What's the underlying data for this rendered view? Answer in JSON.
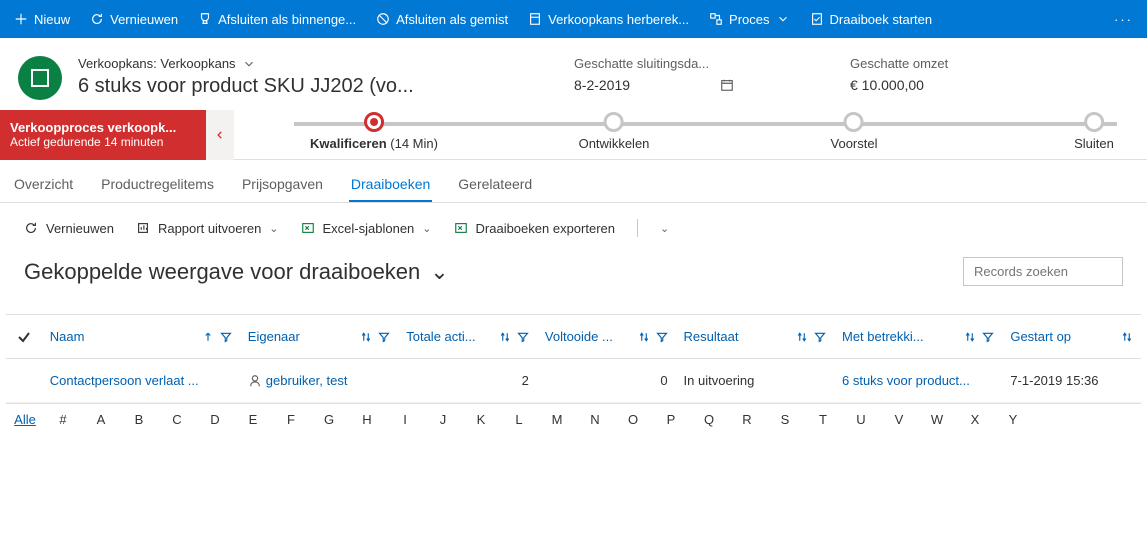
{
  "cmdbar": {
    "nieuw": "Nieuw",
    "vernieuwen": "Vernieuwen",
    "bin": "Afsluiten als binnenge...",
    "gemist": "Afsluiten als gemist",
    "herber": "Verkoopkans herberek...",
    "proces": "Proces",
    "draai": "Draaiboek starten"
  },
  "header": {
    "entity": "Verkoopkans: Verkoopkans",
    "name": "6 stuks voor product SKU JJ202 (vo...",
    "closedate_label": "Geschatte sluitingsda...",
    "closedate": "8-2-2019",
    "revenue_label": "Geschatte omzet",
    "revenue": "€ 10.000,00"
  },
  "bpf": {
    "title": "Verkoopproces verkoopk...",
    "subtitle": "Actief gedurende 14 minuten",
    "s1": "Kwalificeren",
    "s1dur": "(14 Min)",
    "s2": "Ontwikkelen",
    "s3": "Voorstel",
    "s4": "Sluiten"
  },
  "tabs": {
    "overzicht": "Overzicht",
    "prod": "Productregelitems",
    "prijs": "Prijsopgaven",
    "draai": "Draaiboeken",
    "rel": "Gerelateerd"
  },
  "subcmd": {
    "vern": "Vernieuwen",
    "rapport": "Rapport uitvoeren",
    "excel": "Excel-sjablonen",
    "export": "Draaiboeken exporteren"
  },
  "view": {
    "name": "Gekoppelde weergave voor draaiboeken",
    "search_ph": "Records zoeken"
  },
  "cols": {
    "naam": "Naam",
    "eigenaar": "Eigenaar",
    "totale": "Totale acti...",
    "voltooide": "Voltooide ...",
    "resultaat": "Resultaat",
    "metbetr": "Met betrekki...",
    "gestart": "Gestart op"
  },
  "row": {
    "naam": "Contactpersoon verlaat ...",
    "eigenaar": "gebruiker, test",
    "totale": "2",
    "voltooide": "0",
    "resultaat": "In uitvoering",
    "metbetr": "6 stuks voor product...",
    "gestart": "7-1-2019 15:36"
  },
  "alpha": {
    "alle": "Alle",
    "hash": "#",
    "letters": [
      "A",
      "B",
      "C",
      "D",
      "E",
      "F",
      "G",
      "H",
      "I",
      "J",
      "K",
      "L",
      "M",
      "N",
      "O",
      "P",
      "Q",
      "R",
      "S",
      "T",
      "U",
      "V",
      "W",
      "X",
      "Y"
    ]
  }
}
